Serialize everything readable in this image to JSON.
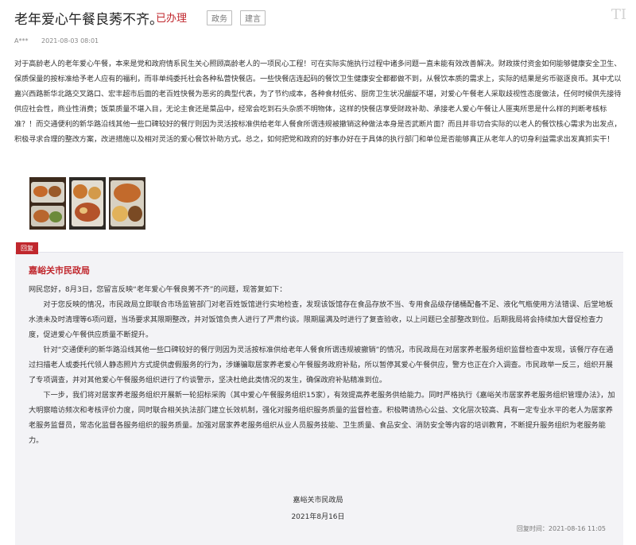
{
  "header": {
    "title": "老年爱心午餐良莠不齐。",
    "status": "已办理",
    "tags": [
      "政务",
      "建言"
    ],
    "logo_text": "TI"
  },
  "meta": {
    "author": "A***",
    "date": "2021-08-03 08:01"
  },
  "content": "对于高龄老人的老年爱心午餐，本来是党和政府情系民生关心照顾高龄老人的一项民心工程！可在实际实施执行过程中诸多问题一直未能有效改善解决。财政拨付资金如何能够健康安全卫生、保质保量的按标准给予老人应有的福利，而非单纯委托社会各种私营快餐店。一些快餐店连起码的餐饮卫生健康安全都都做不到，从餐饮本质的需求上，实际的结果是劣币驱逐良币。其中尤以嘉兴西路新华北路交叉路口、宏丰超市后面的老百姓快餐为恶劣的典型代表，为了节约成本，各种食材低劣、厨房卫生状况龌龊不堪，对爱心午餐老人采取歧视性态度做法，任何时候供先接待供应社会性，商业性消费；饭菜质量不堪入目，无论主食还是菜品中，经常会吃到石头杂质不明物体，这样的快餐店享受财政补助、承接老人爱心午餐让人匪夷所思是什么样的判断考核标准？！而交通便利的新华路沿线其他一些口碑较好的餐厅则因为灵活按标准供给老年人餐食所谓违规被撤销这种做法本身是否武断片面？而且并非切合实际的以老人的餐饮核心需求为出发点，积极寻求合理的整改方案，改进措施以及相对灵活的爱心餐饮补助方式。总之，如何把党和政府的好事办好在于具体的执行部门和单位是否能够真正从老年人的切身利益需求出发真抓实干！",
  "reply": {
    "tag": "回复",
    "org": "嘉峪关市民政局",
    "greeting": "网民您好，8月3日，您留言反映“老年爱心午餐良莠不齐”的问题，现答复如下：",
    "paragraphs": [
      "对于您反映的情况，市民政局立即联合市场监管部门对老百姓饭馆进行实地检查，发现该饭馆存在食品存放不当、专用食品级存储桶配备不足、液化气瓶使用方法错误、后堂地板水渍未及时清理等6项问题，当场要求其限期整改，并对饭馆负责人进行了严肃约谈。限期届满及时进行了复查验收，以上问题已全部整改到位。后期我局将会持续加大督促检查力度，促进爱心午餐供应质量不断提升。",
      "针对“交通便利的新华路沿线其他一些口碑较好的餐厅则因为灵活按标准供给老年人餐食所谓违规被撤销”的情况，市民政局在对居家养老服务组织监督检查中发现，该餐厅存在通过扫描老人或委托代领人静态照片方式提供虚假服务的行为，涉嫌骗取居家养老爱心午餐服务政府补贴，所以暂停其爱心午餐供应，警方也正在介入调查。市民政举一反三，组织开展了专项调查，并对其他爱心午餐服务组织进行了约谈警示，坚决杜绝此类情况的发生，确保政府补贴精准到位。",
      "下一步，我们将对居家养老服务组织开展新一轮招标采购（其中爱心午餐服务组织15家），有效提高养老服务供给能力。同时严格执行《嘉峪关市居家养老服务组织管理办法》，加大明察暗访频次和考核评价力度，同时联合相关执法部门建立长效机制，强化对服务组织服务质量的监督检查。积极聘请热心公益、文化层次较高、具有一定专业水平的老人为居家养老服务监督员，常态化监督各服务组织的服务质量。加强对居家养老服务组织从业人员服务技能、卫生质量、食品安全、消防安全等内容的培训教育，不断提升服务组织为老服务能力。"
    ],
    "signature_org": "嘉峪关市民政局",
    "signature_date": "2021年8月16日",
    "reply_time": "回复时间：2021-08-16 11:05"
  },
  "images": [
    {
      "icon": "food-photo-1"
    },
    {
      "icon": "food-photo-2"
    },
    {
      "icon": "food-photo-3"
    }
  ],
  "colors": {
    "accent": "#c0272d",
    "reply_bg": "#f3f3f6"
  }
}
